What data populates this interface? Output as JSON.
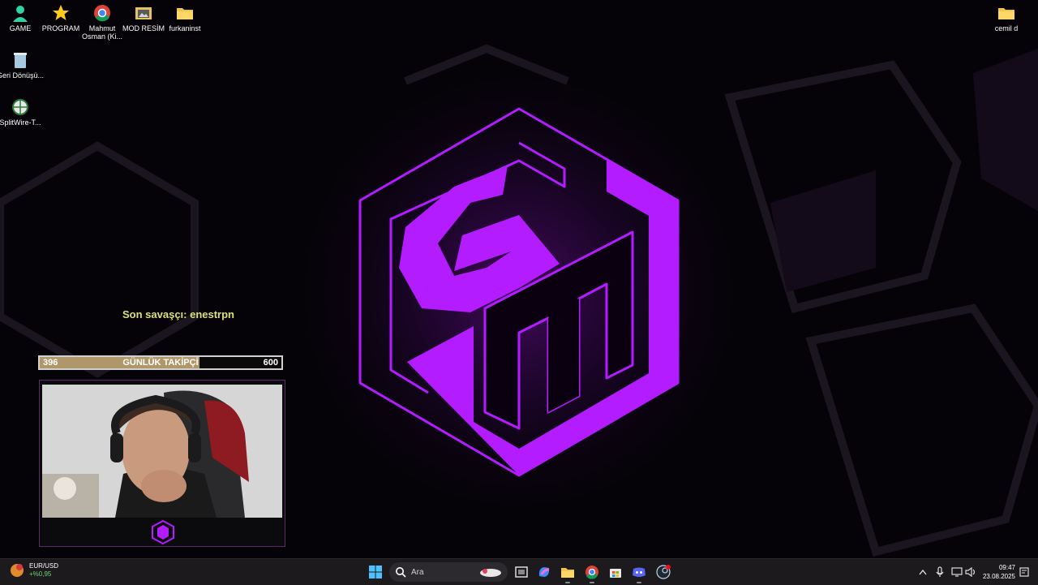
{
  "desktop": {
    "icons": [
      {
        "label": "GAME",
        "icon": "person-icon"
      },
      {
        "label": "PROGRAM",
        "icon": "star-icon"
      },
      {
        "label": "Mahmut Osman (Ki...",
        "icon": "chrome-icon"
      },
      {
        "label": "MOD RESİM",
        "icon": "image-folder-icon"
      },
      {
        "label": "furkaninst",
        "icon": "folder-icon"
      },
      {
        "label": "Geri Dönüşü...",
        "icon": "recycle-bin-icon"
      },
      {
        "label": "SplitWire-T...",
        "icon": "globe-icon"
      },
      {
        "label": "cemil d",
        "icon": "folder-icon"
      }
    ]
  },
  "overlay": {
    "last_warrior": "Son savaşçı: enestrpn",
    "follower_goal": {
      "title": "GÜNLÜK TAKİPÇİ",
      "current": "396",
      "target": "600",
      "progress_fraction": 0.66
    }
  },
  "taskbar": {
    "widget": {
      "pair": "EUR/USD",
      "change": "+%0,95",
      "badge": "5"
    },
    "search_placeholder": "Ara",
    "apps": [
      "start-icon",
      "task-view-icon",
      "copilot-icon",
      "file-explorer-icon",
      "chrome-icon",
      "store-icon",
      "discord-icon",
      "steam-icon"
    ],
    "clock": {
      "time": "09:47",
      "date": "23.08.2025"
    }
  },
  "colors": {
    "accent_purple": "#b21cff",
    "follower_fill": "#b0976a",
    "last_warrior_text": "#d8e27a",
    "taskbar_bg": "#1c1a1d"
  }
}
